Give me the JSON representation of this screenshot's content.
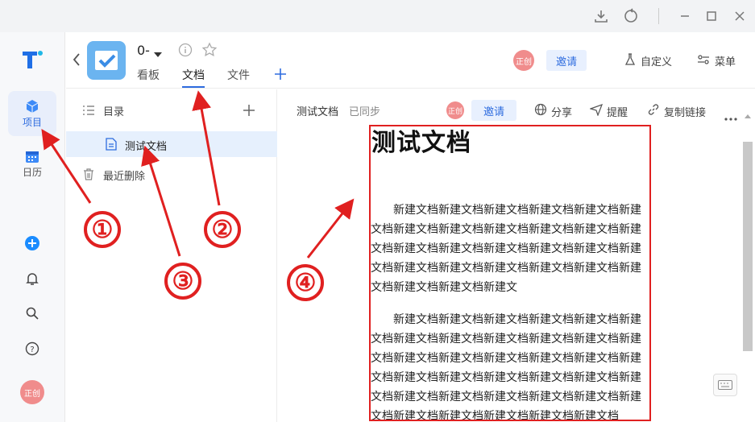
{
  "project": {
    "name": "0-"
  },
  "tabs": [
    {
      "label": "看板"
    },
    {
      "label": "文档"
    },
    {
      "label": "文件"
    }
  ],
  "header_actions": {
    "avatar_text": "正创",
    "invite": "邀请",
    "customize": "自定义",
    "menu": "菜单"
  },
  "leftnav": {
    "project": "项目",
    "calendar": "日历",
    "user_avatar": "正创"
  },
  "tree": {
    "title": "目录",
    "items": [
      {
        "label": "测试文档"
      }
    ],
    "recent_deleted": "最近删除"
  },
  "doc_toolbar": {
    "doc_name": "测试文档",
    "sync_status": "已同步",
    "avatar_text": "正创",
    "invite": "邀请",
    "share": "分享",
    "remind": "提醒",
    "copy_link": "复制链接"
  },
  "document": {
    "title": "测试文档",
    "paragraphs": [
      "新建文档新建文档新建文档新建文档新建文档新建文档新建文档新建文档新建文档新建文档新建文档新建文档新建文档新建文档新建文档新建文档新建文档新建文档新建文档新建文档新建文档新建文档新建文档新建文档新建文档新建文档新建文",
      "新建文档新建文档新建文档新建文档新建文档新建文档新建文档新建文档新建文档新建文档新建文档新建文档新建文档新建文档新建文档新建文档新建文档新建文档新建文档新建文档新建文档新建文档新建文档新建文档新建文档新建文档新建文档新建文档新建文档新建文档新建文档新建文档新建文档新建文档新建文档"
    ]
  },
  "annotations": [
    "①",
    "②",
    "③",
    "④"
  ],
  "colors": {
    "accent": "#2e6cdf",
    "annotation_red": "#e02020",
    "avatar": "#f08c8c"
  }
}
